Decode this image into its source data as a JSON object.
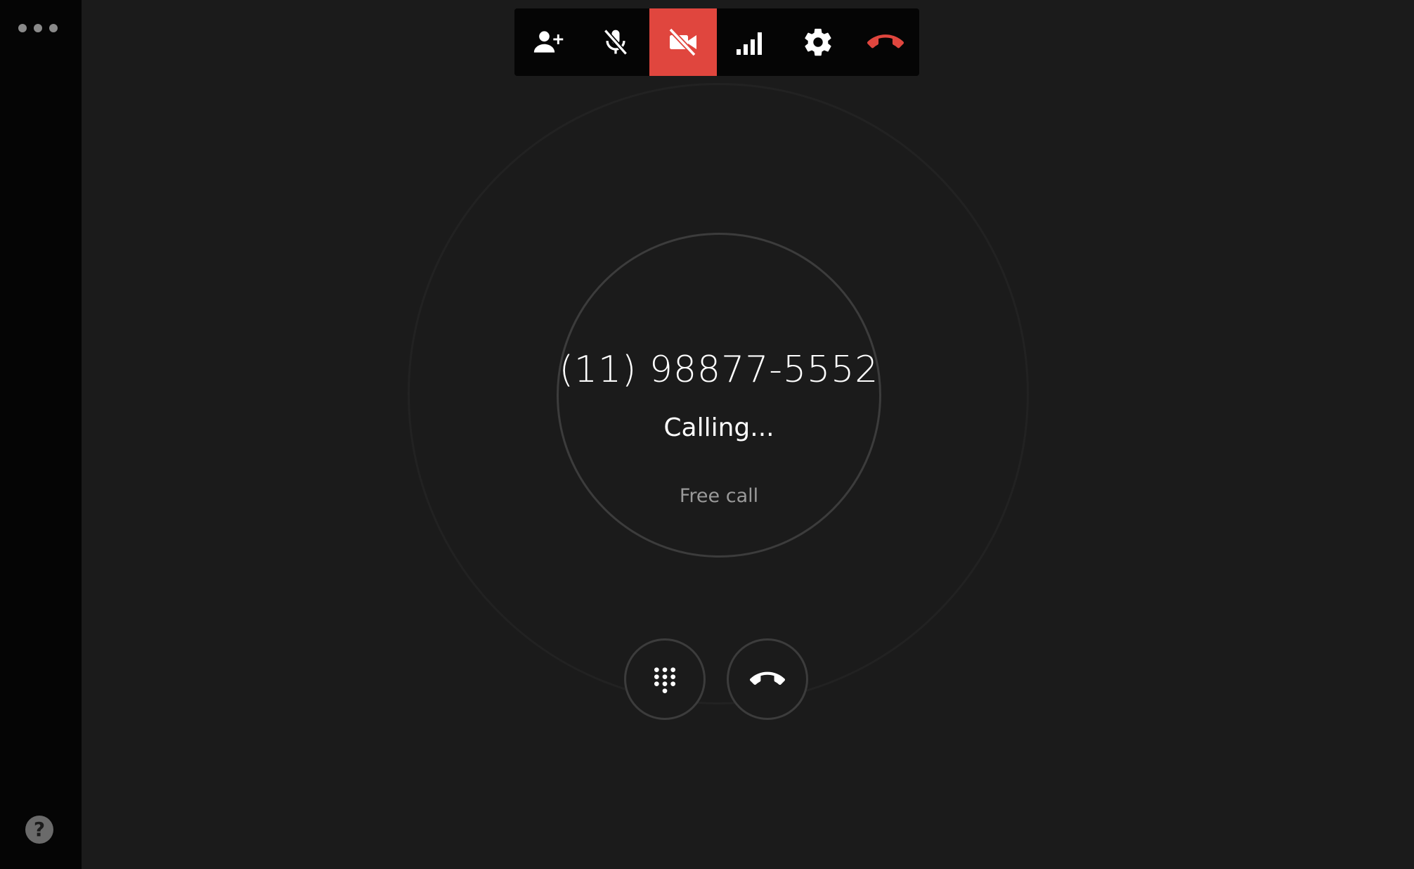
{
  "sidebar": {
    "more_icon": "more-horizontal-icon",
    "help_icon": "help-icon",
    "help_glyph": "?"
  },
  "toolbar": {
    "buttons": [
      {
        "icon": "add-person-icon",
        "active": false
      },
      {
        "icon": "mic-off-icon",
        "active": false
      },
      {
        "icon": "video-off-icon",
        "active": true
      },
      {
        "icon": "signal-strength-icon",
        "active": false
      },
      {
        "icon": "gear-icon",
        "active": false
      },
      {
        "icon": "hang-up-icon",
        "active": false
      }
    ]
  },
  "call": {
    "number": "(11) 98877-5552",
    "status": "Calling...",
    "subtext": "Free call"
  },
  "controls": {
    "keypad_icon": "dialpad-icon",
    "hangup_icon": "hang-up-icon"
  },
  "colors": {
    "background": "#1b1b1b",
    "sidebar": "#050505",
    "accent_red": "#e0463e",
    "text_primary": "#ffffff",
    "text_secondary": "#9a9a9a"
  }
}
